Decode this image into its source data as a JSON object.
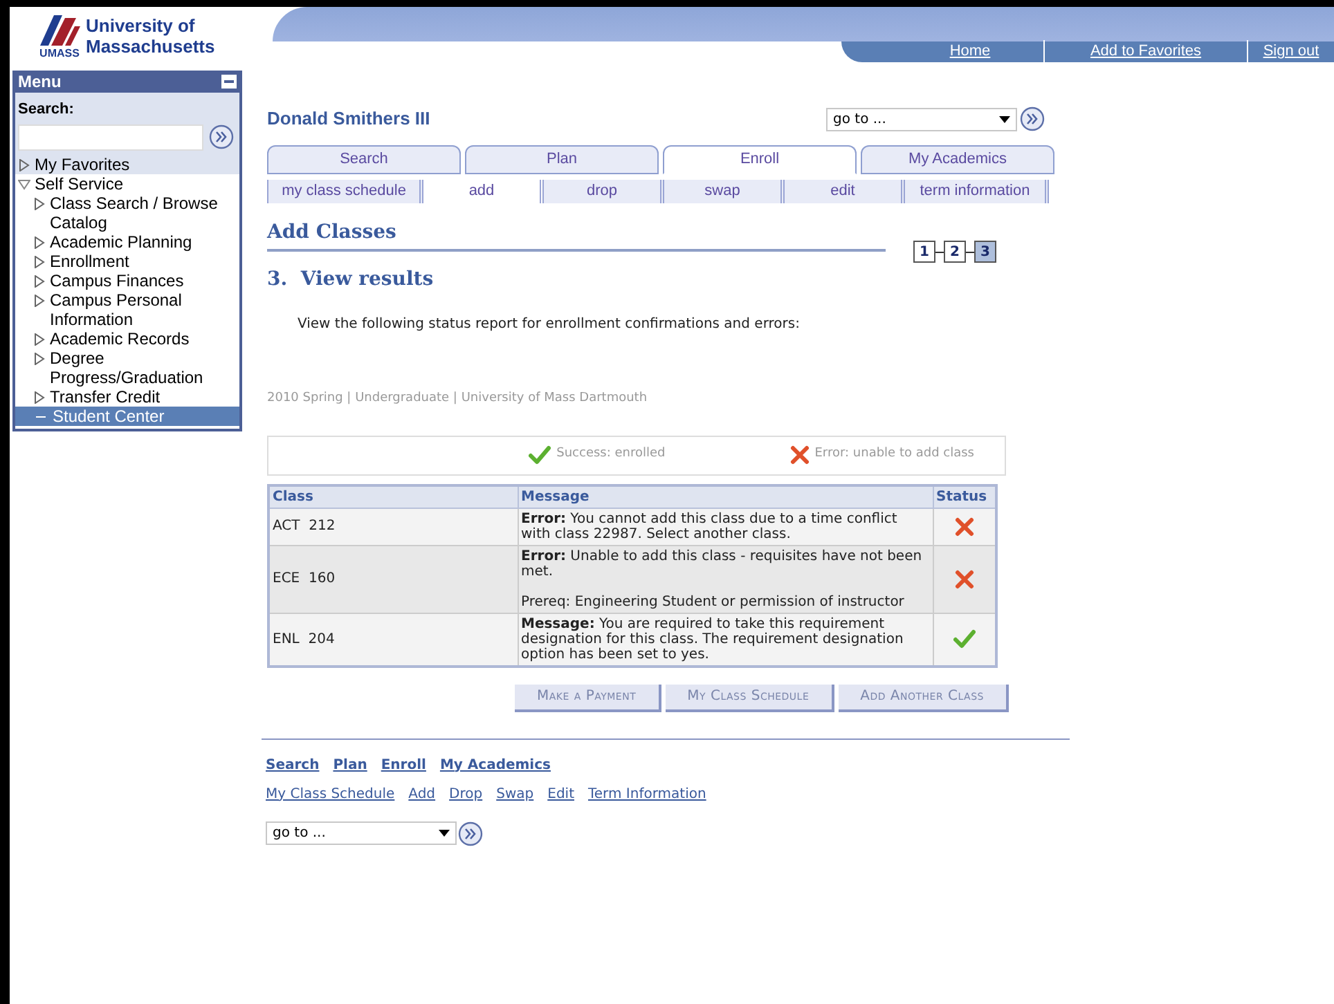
{
  "logo": {
    "line1": "University of",
    "line2": "Massachusetts",
    "mark": "UMASS"
  },
  "top_nav": [
    "Home",
    "Add to Favorites",
    "Sign out"
  ],
  "menu": {
    "title": "Menu",
    "search_label": "Search:",
    "items": [
      {
        "label": "My Favorites",
        "expanded": false,
        "selected": false
      },
      {
        "label": "Self Service",
        "expanded": true,
        "selected": false,
        "children": [
          {
            "label": "Class Search / Browse Catalog",
            "expanded": false,
            "selected": false
          },
          {
            "label": "Academic Planning",
            "expanded": false,
            "selected": false
          },
          {
            "label": "Enrollment",
            "expanded": false,
            "selected": false
          },
          {
            "label": "Campus Finances",
            "expanded": false,
            "selected": false
          },
          {
            "label": "Campus Personal Information",
            "expanded": false,
            "selected": false
          },
          {
            "label": "Academic Records",
            "expanded": false,
            "selected": false
          },
          {
            "label": "Degree Progress/Graduation",
            "expanded": false,
            "selected": false
          },
          {
            "label": "Transfer Credit",
            "expanded": false,
            "selected": false
          },
          {
            "label": "Student Center",
            "kind": "leaf",
            "selected": true
          }
        ]
      }
    ]
  },
  "student_name": "Donald Smithers III",
  "goto_top": {
    "value": "go to ..."
  },
  "tabs": [
    {
      "label": "Search",
      "selected": false
    },
    {
      "label": "Plan",
      "selected": false
    },
    {
      "label": "Enroll",
      "selected": true
    },
    {
      "label": "My Academics",
      "selected": false
    }
  ],
  "subtabs": [
    {
      "label": "my class schedule",
      "selected": false
    },
    {
      "label": "add",
      "selected": true
    },
    {
      "label": "drop",
      "selected": false
    },
    {
      "label": "swap",
      "selected": false
    },
    {
      "label": "edit",
      "selected": false
    },
    {
      "label": "term information",
      "selected": false
    }
  ],
  "page_title": "Add Classes",
  "steps": [
    {
      "label": "1",
      "selected": false
    },
    {
      "label": "2",
      "selected": false
    },
    {
      "label": "3",
      "selected": true
    }
  ],
  "step_heading": "3.  View results",
  "instructions": "View the following status report for enrollment confirmations and errors:",
  "term_info": "2010 Spring | Undergraduate | University of Mass Dartmouth",
  "legend": [
    {
      "kind": "success",
      "label": "Success: enrolled"
    },
    {
      "kind": "error",
      "label": "Error: unable to add class"
    }
  ],
  "table": {
    "columns": [
      "Class",
      "Message",
      "Status"
    ],
    "rows": [
      {
        "class": "ACT  212",
        "message": [
          "**Error:** You cannot add this class due to a time conflict with class 22987. Select another class."
        ],
        "kind": "error"
      },
      {
        "class": "ECE  160",
        "message": [
          "**Error:** Unable to add this class - requisites have not been met.",
          "Prereq: Engineering Student or permission of instructor"
        ],
        "kind": "error"
      },
      {
        "class": "ENL  204",
        "message": [
          "**Message:** You are required to take this requirement designation for this class. The requirement designation option has been set to yes."
        ],
        "kind": "success"
      }
    ]
  },
  "buttons": [
    "Make a Payment",
    "My Class Schedule",
    "Add Another Class"
  ],
  "bottom_links": [
    "Search",
    "Plan",
    "Enroll",
    "My Academics"
  ],
  "bottom_sublinks": [
    "My Class Schedule",
    "Add",
    "Drop",
    "Swap",
    "Edit",
    "Term Information"
  ],
  "goto_bottom": {
    "value": "go to ..."
  }
}
